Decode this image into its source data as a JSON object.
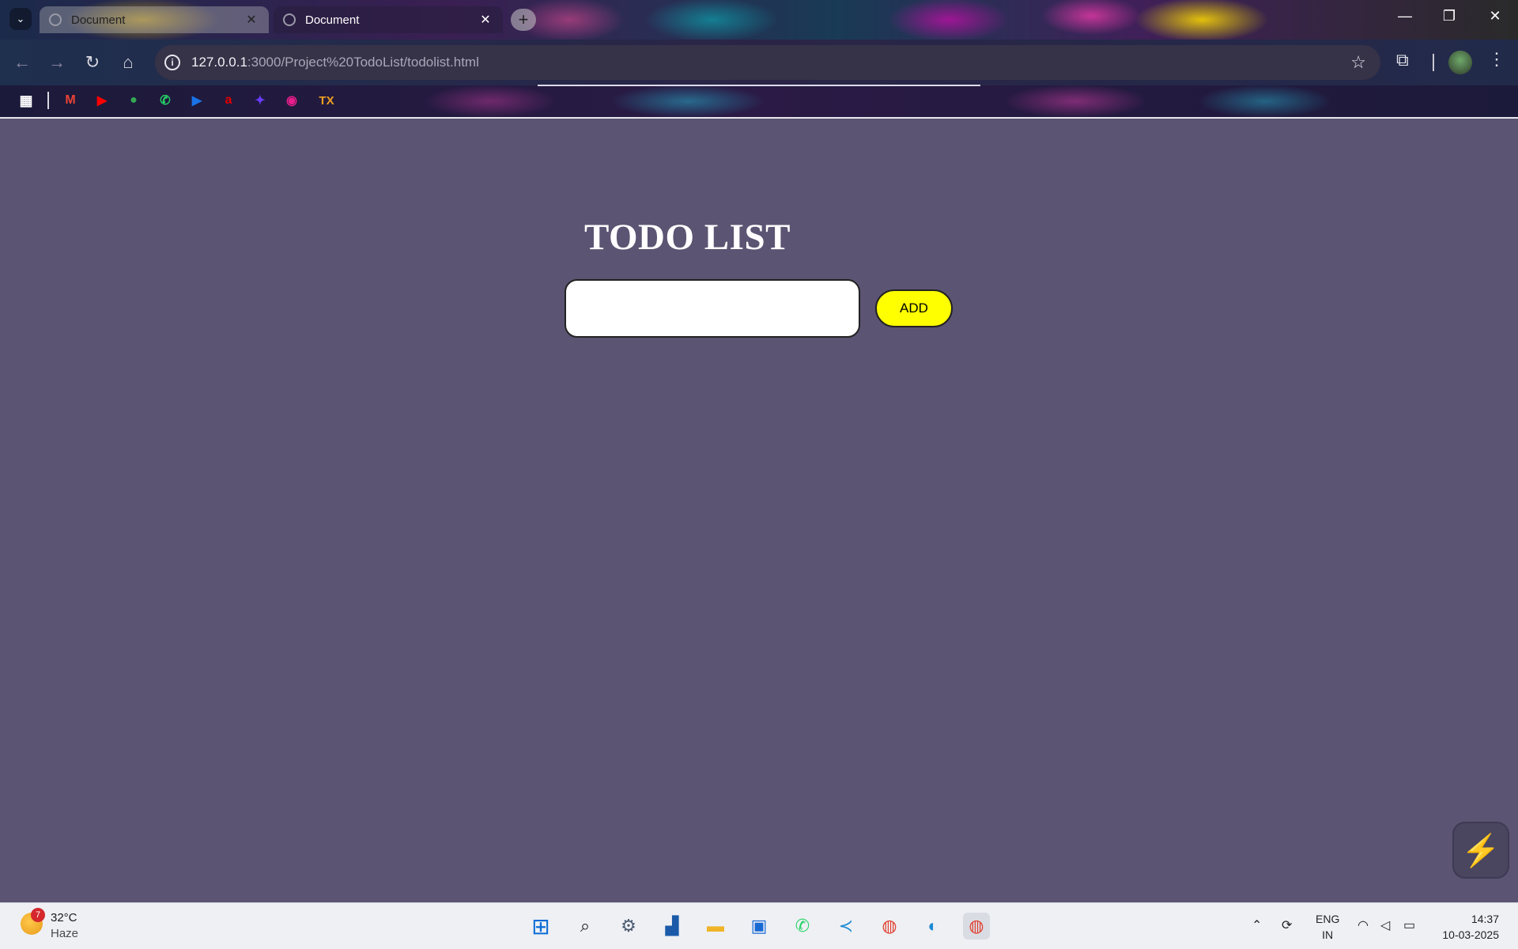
{
  "browser": {
    "tabs": [
      {
        "title": "Document",
        "state": "inactive"
      },
      {
        "title": "Document",
        "state": "active"
      }
    ],
    "new_tab_label": "+",
    "url_host": "127.0.0.1",
    "url_path": ":3000/Project%20TodoList/todolist.html",
    "bookmarks": [
      {
        "name": "gmail-icon",
        "glyph": "M",
        "color": "#ea4335"
      },
      {
        "name": "youtube-icon",
        "glyph": "▶",
        "color": "#ff0000"
      },
      {
        "name": "maps-icon",
        "glyph": "●",
        "color": "#34a853"
      },
      {
        "name": "whatsapp-icon",
        "glyph": "✆",
        "color": "#25d366"
      },
      {
        "name": "play-icon",
        "glyph": "▶",
        "color": "#1a73e8"
      },
      {
        "name": "airtel-icon",
        "glyph": "a",
        "color": "#e40000"
      },
      {
        "name": "app-icon",
        "glyph": "✦",
        "color": "#6a3cff"
      },
      {
        "name": "store-icon",
        "glyph": "◉",
        "color": "#e91e8c"
      }
    ],
    "bookmark_text": "TX"
  },
  "page": {
    "title": "TODO LIST",
    "input_value": "",
    "input_placeholder": "",
    "add_label": "ADD",
    "colors": {
      "background": "#5b5472",
      "button": "#ffff00"
    }
  },
  "taskbar": {
    "weather_badge": "7",
    "temperature": "32°C",
    "condition": "Haze",
    "language_line1": "ENG",
    "language_line2": "IN",
    "time": "14:37",
    "date": "10-03-2025"
  }
}
